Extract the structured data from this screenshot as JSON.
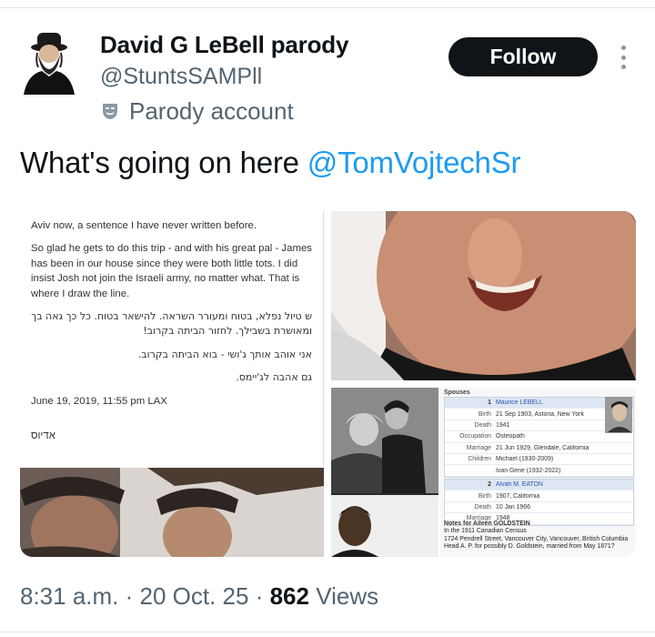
{
  "author": {
    "name": "David G LeBell parody",
    "handle": "@StuntsSAMPll",
    "label": "Parody account",
    "avatar_icon": "avatar-bearded-man-icon",
    "label_icon": "parody-mask-icon"
  },
  "actions": {
    "follow_label": "Follow",
    "more_icon": "more-vertical-icon"
  },
  "tweet": {
    "text": "What's going on here ",
    "mention": "@TomVojtechSr"
  },
  "media": {
    "document": {
      "lines": [
        "Aviv now, a sentence I have never written before.",
        "So glad he gets to do this trip - and with his great pal - James has been in our house since they were both little tots. I did insist Josh not join the Israeli army, no matter what. That is where I draw the line.",
        "ש טיול נפלא, בטוח ומעורר השראה. להישאר בטוח. כל כך גאה בך ומאושרת בשבילך. לחזור הביתה בקרוב!",
        "אני אוהב אותך ג'ושי - בוא הביתה בקרוב.",
        "גם אהבה לג'יימס.",
        "June 19, 2019, 11:55 pm LAX",
        "אדיוס"
      ]
    },
    "genealogy": {
      "title": "Spouses",
      "spouse1": {
        "num": "1",
        "name": "Maurice LEBELL",
        "birth_label": "Birth",
        "birth": "21 Sep 1903, Astoria, New York",
        "death_label": "Death",
        "death": "1941",
        "occupation_label": "Occupation",
        "occupation": "Osteopath",
        "marriage_label": "Marriage",
        "marriage": "21 Jun 1929, Glendale, California",
        "children_label": "Children",
        "child1": "Michael (1930-2009)",
        "child2": "Ivan Gene (1932-2022)"
      },
      "spouse2": {
        "num": "2",
        "name": "Alvah M. EATON",
        "birth_label": "Birth",
        "birth": "1907, California",
        "death_label": "Death",
        "death": "10 Jan 1966",
        "marriage_label": "Marriage",
        "marriage": "1948"
      },
      "notes_title": "Notes for Aileen GOLDSTEIN",
      "notes": [
        "In the 1911 Canadian Census",
        "1724 Pendrell Street, Vancouver City, Vancouver, British Columbia",
        "Head A. P. for possibly D. Goldstein, married from May 1871?"
      ]
    }
  },
  "footer": {
    "time": "8:31 a.m.",
    "sep1": " · ",
    "date": "20 Oct. 25",
    "sep2": " · ",
    "views_count": "862",
    "views_label": " Views"
  }
}
